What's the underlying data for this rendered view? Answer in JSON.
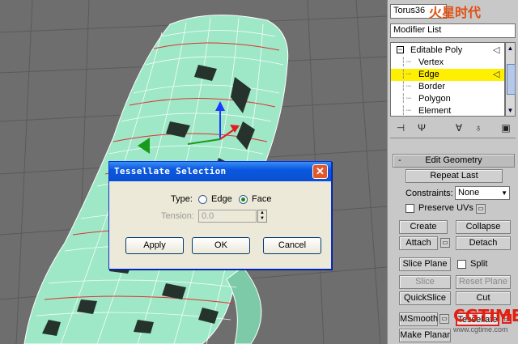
{
  "dialog": {
    "title": "Tessellate Selection",
    "type_label": "Type:",
    "option_edge": "Edge",
    "option_face": "Face",
    "selected_type": "Face",
    "tension_label": "Tension:",
    "tension_value": "0.0",
    "apply_label": "Apply",
    "ok_label": "OK",
    "cancel_label": "Cancel",
    "close_icon": "close-icon"
  },
  "panel": {
    "object_name": "Torus36",
    "modifier_list": "Modifier List",
    "stack": {
      "root": "Editable Poly",
      "items": [
        "Vertex",
        "Edge",
        "Border",
        "Polygon",
        "Element"
      ],
      "selected": "Edge"
    },
    "toolbar_icons": [
      "pin-stack-icon",
      "show-end-result-icon",
      "make-unique-icon",
      "remove-modifier-icon",
      "configure-sets-icon"
    ],
    "rollout": {
      "minus": "-",
      "title": "Edit Geometry",
      "repeat_last": "Repeat Last",
      "constraints_label": "Constraints:",
      "constraints_value": "None",
      "preserve_uvs": "Preserve UVs",
      "create": "Create",
      "collapse": "Collapse",
      "attach": "Attach",
      "detach": "Detach",
      "slice_plane": "Slice Plane",
      "split": "Split",
      "slice": "Slice",
      "reset_plane": "Reset Plane",
      "quickslice": "QuickSlice",
      "cut": "Cut",
      "msmooth": "MSmooth",
      "tessellate": "Tessellate",
      "make_planar": "Make Planar"
    }
  },
  "watermarks": {
    "top": "火星时代",
    "bottom": "CGTIME",
    "bottom_url": "www.cgtime.com"
  },
  "colors": {
    "accent_selection": "#ffef00",
    "titlebar": "#0a58e0",
    "mesh": "#9ee8c8"
  }
}
